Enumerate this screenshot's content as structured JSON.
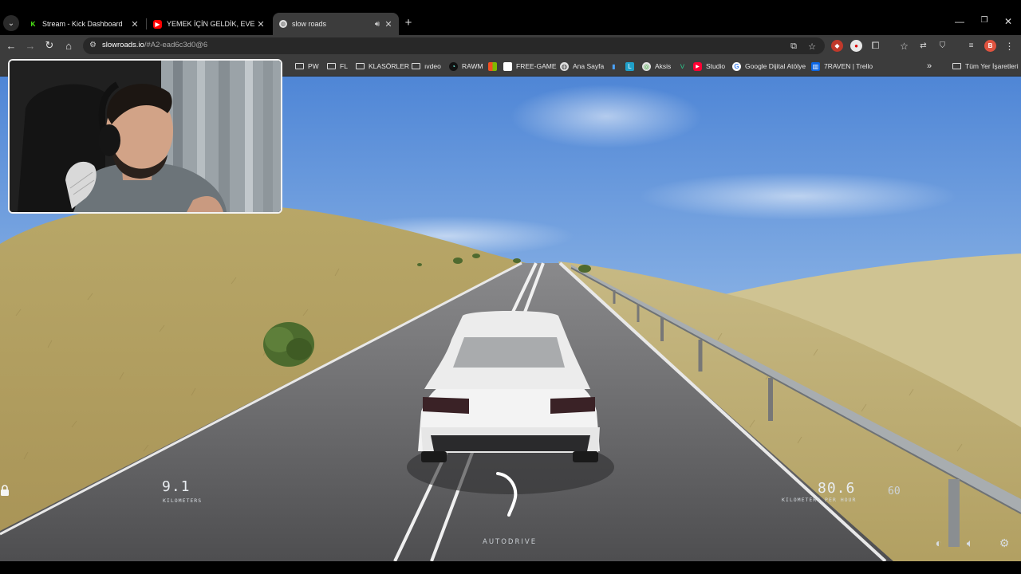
{
  "browser": {
    "tabs": [
      {
        "title": "Stream - Kick Dashboard",
        "icon": "kick-icon",
        "color": "#53fc18"
      },
      {
        "title": "YEMEK İÇİN GELDİK, EVE ALMA",
        "icon": "youtube-icon",
        "color": "#ff0000"
      },
      {
        "title": "slow roads",
        "icon": "globe-icon",
        "active": true,
        "audio": true
      }
    ],
    "address": {
      "domain": "slowroads.io",
      "path": "/#A2-ead6c3d0@6"
    },
    "bookmarks": [
      {
        "label": "PW",
        "type": "folder"
      },
      {
        "label": "FL",
        "type": "folder"
      },
      {
        "label": "KLASÖRLER",
        "type": "folder"
      },
      {
        "label": "ıvdeo",
        "type": "folder"
      },
      {
        "label": "RAWM",
        "type": "site"
      },
      {
        "label": "FREE-GAME",
        "type": "site"
      },
      {
        "label": "Ana Sayfa",
        "type": "site"
      },
      {
        "label": "Aksis",
        "type": "site"
      },
      {
        "label": "Studio",
        "type": "site"
      },
      {
        "label": "Google Dijital Atölye",
        "type": "site"
      },
      {
        "label": "7RAVEN | Trello",
        "type": "site"
      }
    ],
    "all_bookmarks": "Tüm Yer İşaretleri",
    "profile_initial": "B"
  },
  "game": {
    "distance_value": "9.1",
    "distance_unit": "KILOMETERS",
    "speed_value": "80.6",
    "speed_unit": "KILOMETERS PER HOUR",
    "speed_limit": "60",
    "autodrive_label": "AUTODRIVE",
    "colors": {
      "sky_top": "#4f86d6",
      "sky_horizon": "#c9dcef",
      "grass": "#b9a566",
      "road": "#58585a"
    }
  }
}
